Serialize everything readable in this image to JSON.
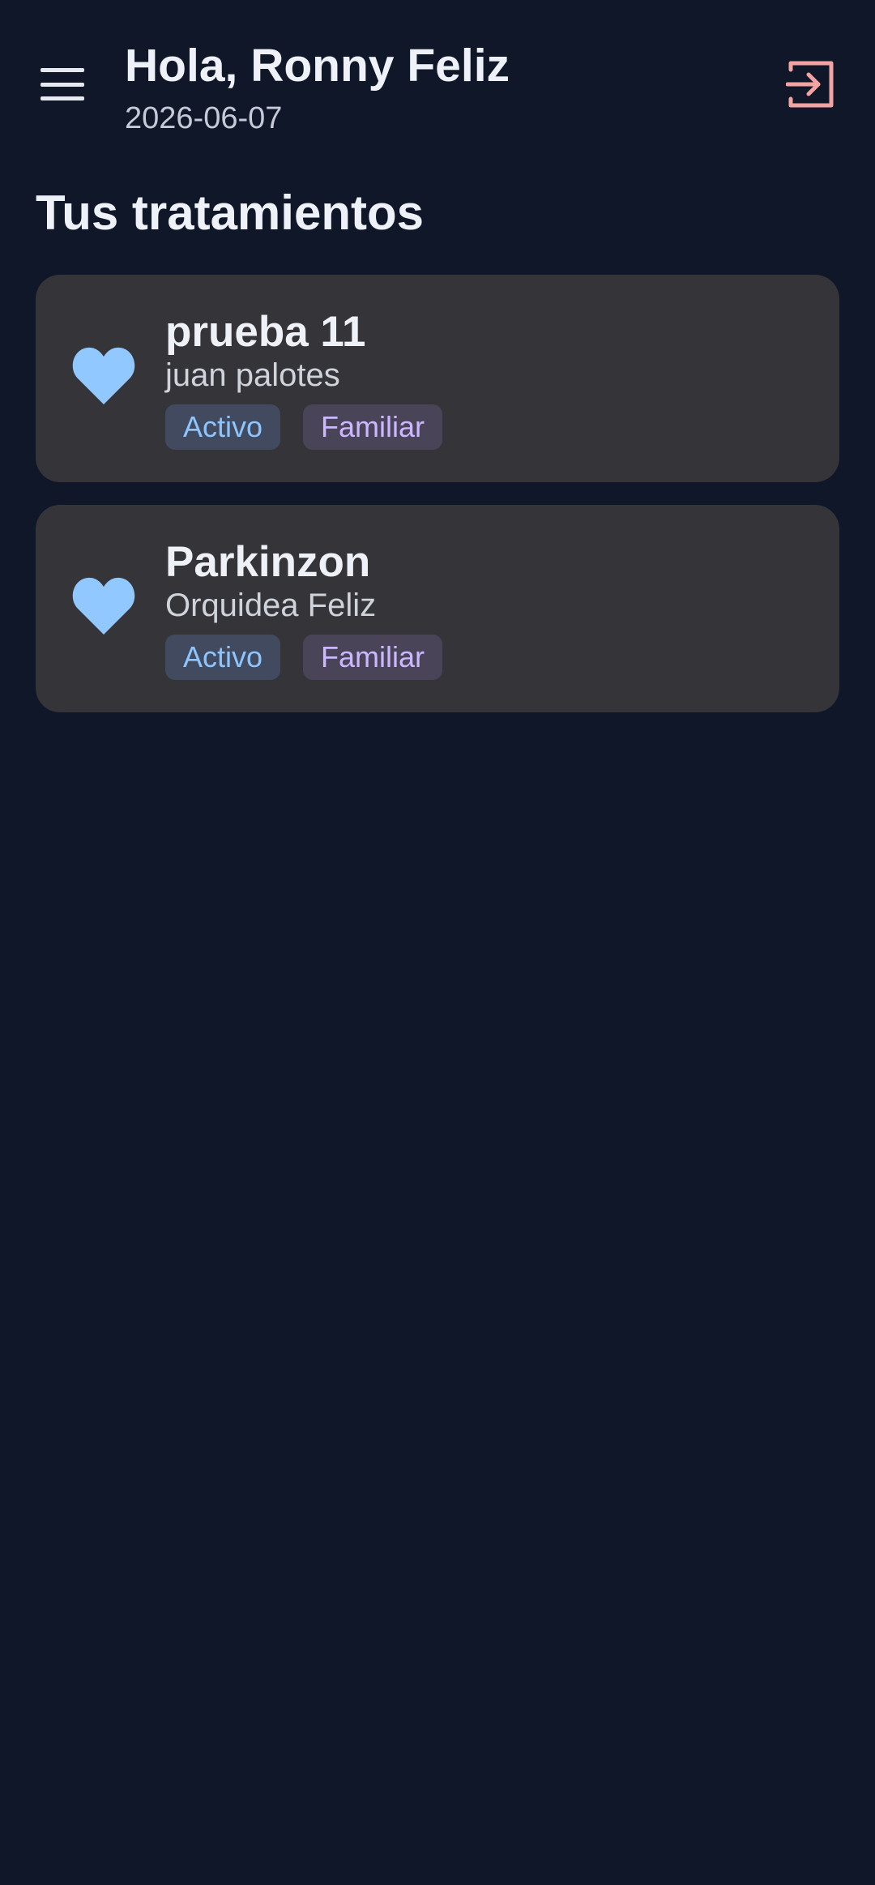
{
  "header": {
    "greeting": "Hola, Ronny Feliz",
    "date": "2026-06-07",
    "menu_icon": "hamburger-menu-icon",
    "logout_icon": "logout-icon",
    "logout_color": "#f4a3a3"
  },
  "section": {
    "title": "Tus tratamientos"
  },
  "treatments": [
    {
      "name": "prueba 11",
      "patient": "juan palotes",
      "status": "Activo",
      "type": "Familiar",
      "icon": "heart-icon"
    },
    {
      "name": "Parkinzon",
      "patient": "Orquidea Feliz",
      "status": "Activo",
      "type": "Familiar",
      "icon": "heart-icon"
    }
  ],
  "colors": {
    "background": "#0f1729",
    "card": "#353439",
    "heart": "#90c8ff",
    "status_text": "#8ec5ff",
    "type_text": "#cdb8ff"
  }
}
